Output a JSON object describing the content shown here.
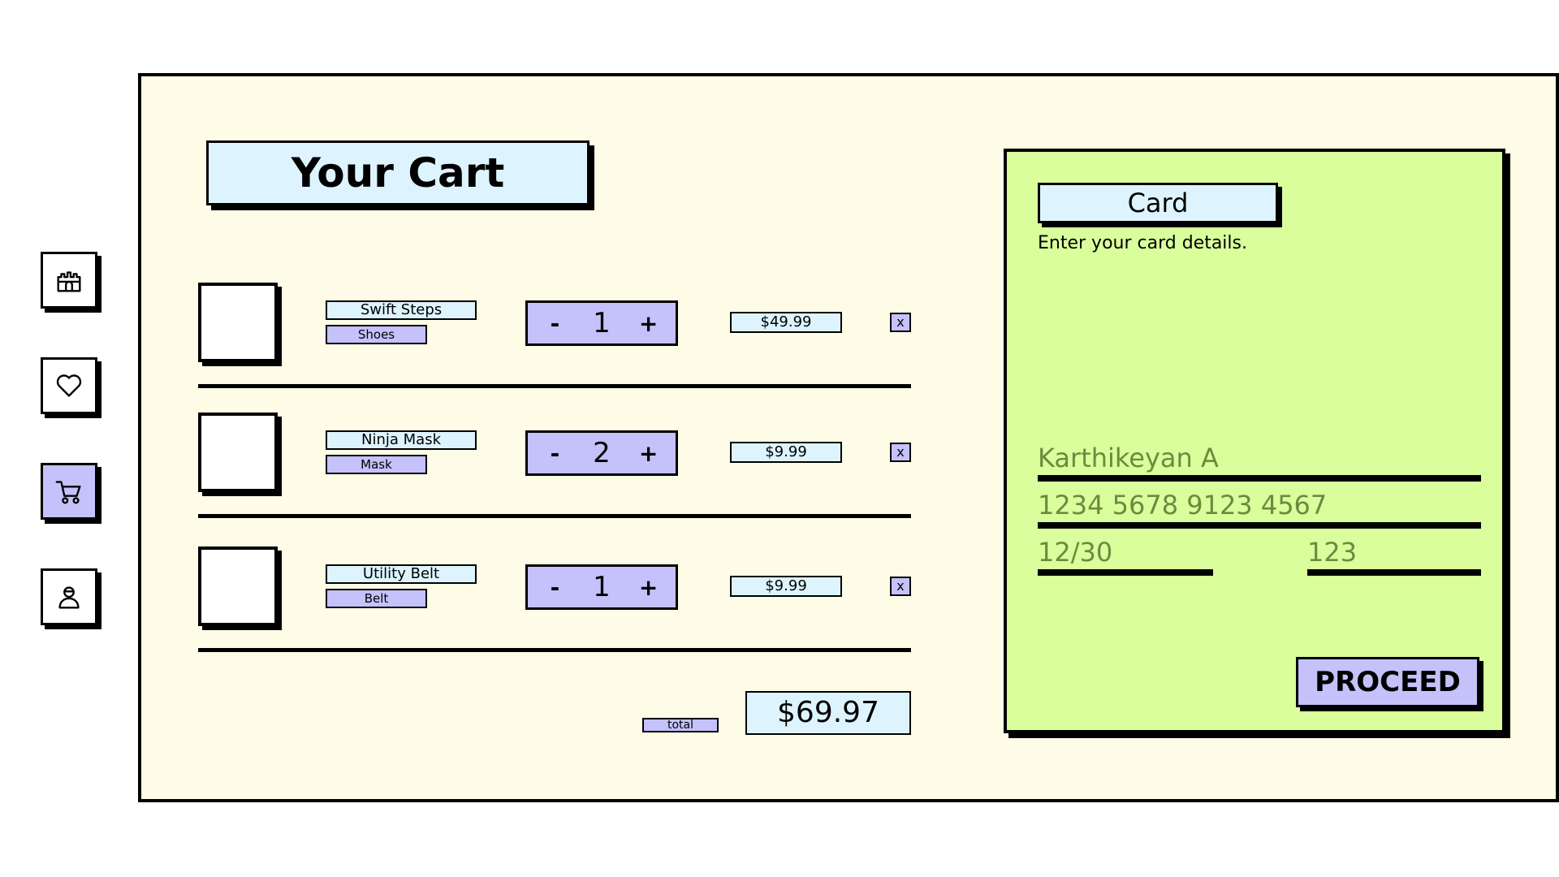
{
  "nav": {
    "items": [
      {
        "icon": "castle-icon",
        "active": false
      },
      {
        "icon": "heart-icon",
        "active": false
      },
      {
        "icon": "cart-icon",
        "active": true
      },
      {
        "icon": "ninja-profile-icon",
        "active": false
      }
    ]
  },
  "cart": {
    "title": "Your Cart",
    "items": [
      {
        "name": "Swift Steps",
        "category": "Shoes",
        "quantity": "1",
        "price": "$49.99",
        "minus": "-",
        "plus": "+",
        "remove": "x"
      },
      {
        "name": "Ninja Mask",
        "category": "Mask",
        "quantity": "2",
        "price": "$9.99",
        "minus": "-",
        "plus": "+",
        "remove": "x"
      },
      {
        "name": "Utility Belt",
        "category": "Belt",
        "quantity": "1",
        "price": "$9.99",
        "minus": "-",
        "plus": "+",
        "remove": "x"
      }
    ],
    "total_label": "total",
    "total_value": "$69.97"
  },
  "card": {
    "title": "Card",
    "description": "Enter your card details.",
    "name_placeholder": "Karthikeyan A",
    "number_placeholder": "1234 5678 9123 4567",
    "expiry_placeholder": "12/30",
    "cvv_placeholder": "123",
    "proceed_label": "PROCEED"
  },
  "colors": {
    "panel_bg": "#fefbe7",
    "light_blue": "#ddf4ff",
    "lavender": "#c4c1fb",
    "lime": "#dafe9b",
    "placeholder": "#6c8a3f"
  }
}
